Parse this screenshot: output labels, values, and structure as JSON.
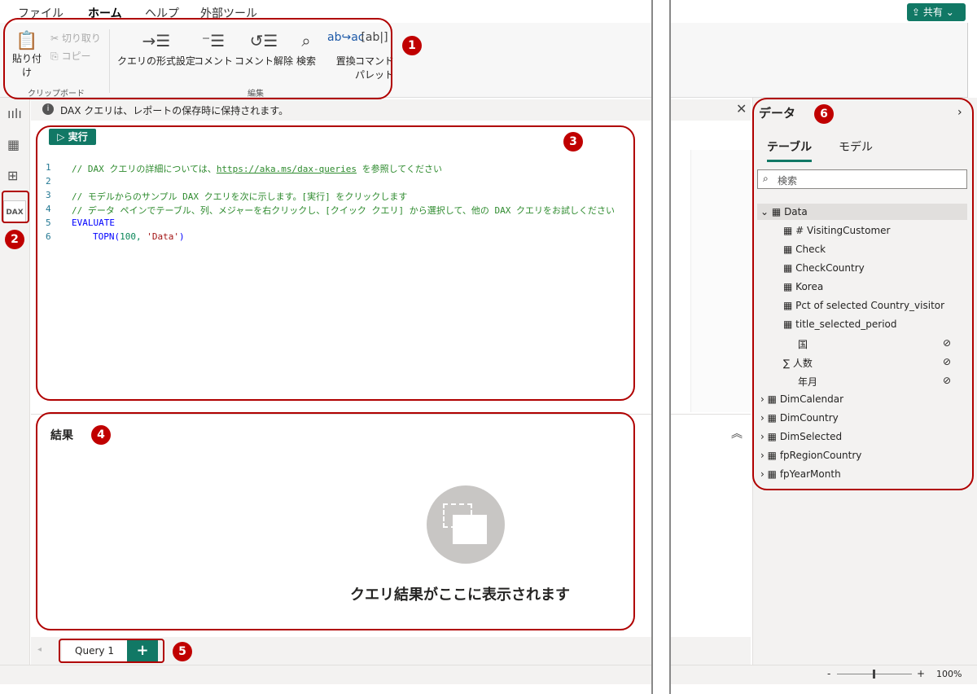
{
  "menu": {
    "file": "ファイル",
    "home": "ホーム",
    "help": "ヘルプ",
    "external": "外部ツール"
  },
  "share": {
    "label": "共有"
  },
  "ribbon": {
    "paste": "貼り付け",
    "cut": "切り取り",
    "copy": "コピー",
    "clipboard": "クリップボード",
    "format": "クエリの形式設定",
    "comment": "コメント",
    "uncomment": "コメント解除",
    "search": "検索",
    "replace": "置換",
    "palette1": "コマンド",
    "palette2": "パレット",
    "edit": "編集"
  },
  "info": {
    "text": "DAX クエリは、レポートの保存時に保持されます。"
  },
  "run": {
    "label": "▷ 実行"
  },
  "code": {
    "lines": [
      "1",
      "2",
      "3",
      "4",
      "5",
      "6"
    ],
    "l1a": "// DAX クエリの詳細については、",
    "l1link": "https://aka.ms/dax-queries",
    "l1b": " を参照してください",
    "l3": "// モデルからのサンプル DAX クエリを次に示します。[実行] をクリックします",
    "l4": "// データ ペインでテーブル、列、メジャーを右クリックし、[クイック クエリ] から選択して、他の DAX クエリをお試しください",
    "l5": "EVALUATE",
    "l6a": "TOPN(",
    "l6b": "100, ",
    "l6c": "'Data'",
    "l6d": ")"
  },
  "results": {
    "title": "結果",
    "empty": "クエリ結果がここに表示されます"
  },
  "tabs": {
    "query1": "Query 1",
    "add": "+"
  },
  "zoom": {
    "minus": "-",
    "plus": "+",
    "value": "100%"
  },
  "data_pane": {
    "title": "データ",
    "tab_table": "テーブル",
    "tab_model": "モデル",
    "search_placeholder": "検索",
    "tables": [
      "Data",
      "DimCalendar",
      "DimCountry",
      "DimSelected",
      "fpRegionCountry",
      "fpYearMonth"
    ],
    "fields": [
      "# VisitingCustomer",
      "Check",
      "CheckCountry",
      "Korea",
      "Pct of selected Country_visitor",
      "title_selected_period",
      "国",
      "人数",
      "年月"
    ]
  },
  "badges": [
    "1",
    "2",
    "3",
    "4",
    "5",
    "6"
  ],
  "colors": {
    "accent": "#117865",
    "highlight": "#b00000"
  }
}
